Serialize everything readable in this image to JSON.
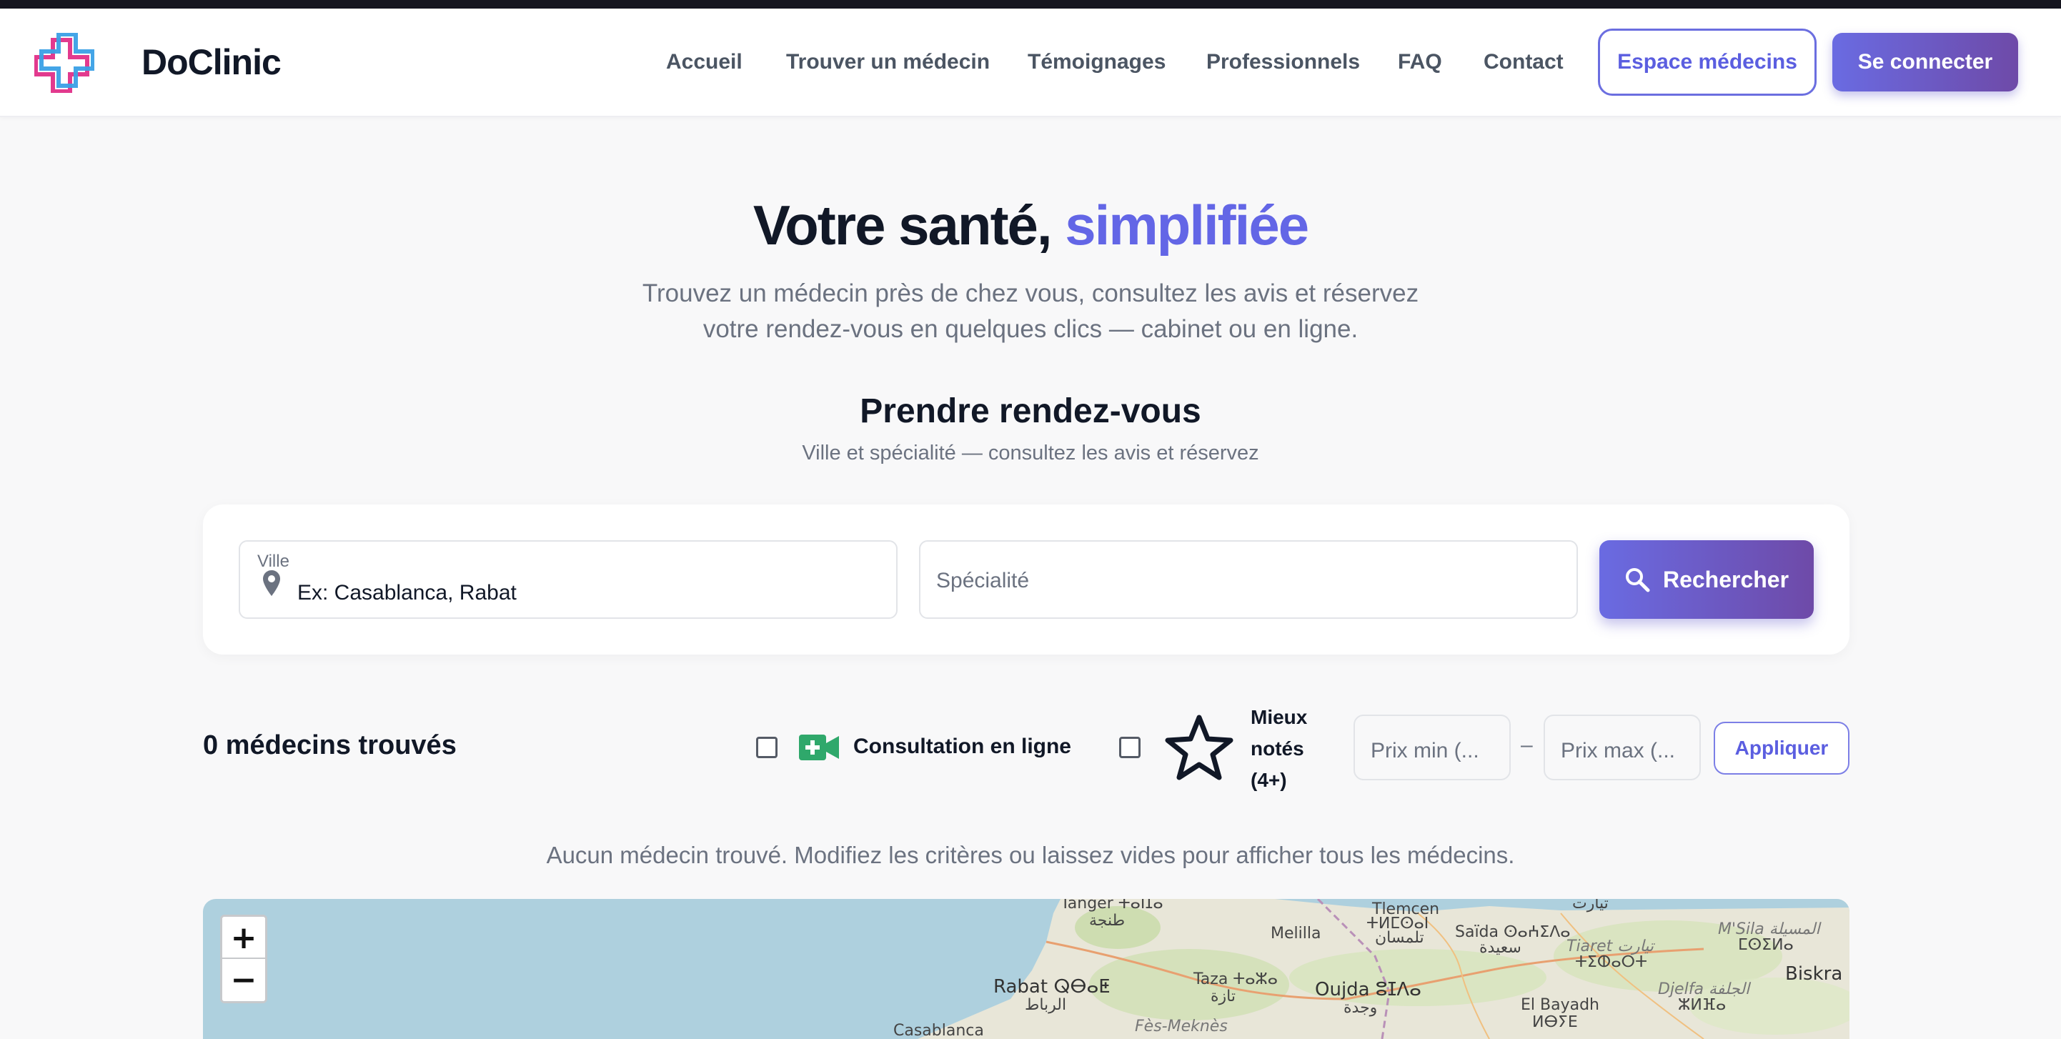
{
  "brand": {
    "name": "DoClinic",
    "colors": {
      "primary": "#6366e6",
      "gradient_end": "#6e4aa8",
      "logo_pink": "#e23a8e",
      "logo_blue": "#3aa0e6"
    }
  },
  "nav": {
    "links": [
      "Accueil",
      "Trouver un médecin",
      "Témoignages",
      "Professionnels",
      "FAQ",
      "Contact"
    ],
    "doctor_space_label": "Espace médecins",
    "login_label": "Se connecter"
  },
  "hero": {
    "title_main": "Votre santé,",
    "title_accent": "simplifiée",
    "subtitle_line1": "Trouvez un médecin près de chez vous, consultez les avis et réservez",
    "subtitle_line2": "votre rendez-vous en quelques clics — cabinet ou en ligne."
  },
  "booking": {
    "title": "Prendre rendez-vous",
    "subtitle": "Ville et spécialité — consultez les avis et réservez",
    "city_label": "Ville",
    "city_placeholder": "Ex: Casablanca, Rabat",
    "specialty_placeholder": "Spécialité",
    "search_label": "Rechercher"
  },
  "filters": {
    "results_count": "0 médecins trouvés",
    "online_label": "Consultation en ligne",
    "online_checked": false,
    "rated_label_line1": "Mieux",
    "rated_label_line2": "notés",
    "rated_label_line3": "(4+)",
    "rated_checked": false,
    "price_min_placeholder": "Prix min (...",
    "price_max_placeholder": "Prix max (...",
    "price_separator": "–",
    "apply_label": "Appliquer"
  },
  "results": {
    "empty_message": "Aucun médecin trouvé. Modifiez les critères ou laissez vides pour afficher tous les médecins."
  },
  "map": {
    "zoom_in": "+",
    "zoom_out": "−",
    "labels": {
      "tanger": "Tanger ⵜⴰⵏⵊⴰ",
      "tanger_ar": "طنجة",
      "rabat": "Rabat ⵕⴱⴰⵟ",
      "rabat_ar": "الرباط",
      "casablanca": "Casablanca",
      "taza": "Taza ⵜⴰⵣⴰ",
      "taza_ar": "تازة",
      "fes": "Fès-Meknès",
      "oujda": "Oujda ⵓⵊⴷⴰ",
      "oujda_ar": "وجدة",
      "tlemcen": "Tlemcen",
      "tlemcen_tz": "ⵜⵍⵎⵙⴰⵏ",
      "tlemcen_ar": "تلمسان",
      "melilla": "Melilla",
      "saida": "Saïda ⵙⴰⵄⵉⴷⴰ",
      "saida_ar": "سعيدة",
      "tiaret": "Tiaret تيارت",
      "tiaret_tz": "ⵜⵉⵀⴰⵔⵜ",
      "tiaret_ar": "تيارت",
      "msila": "M'Sila المسيلة",
      "msila_tz": "ⵎⵙⵉⵍⴰ",
      "djelfa": "Djelfa الجلفة",
      "djelfa_tz": "ⵣⵍⴼⴰ",
      "elbayadh": "El Bayadh",
      "elbayadh_tz": "ⵍⴱⵢⴹ",
      "biskra": "Biskra"
    }
  }
}
